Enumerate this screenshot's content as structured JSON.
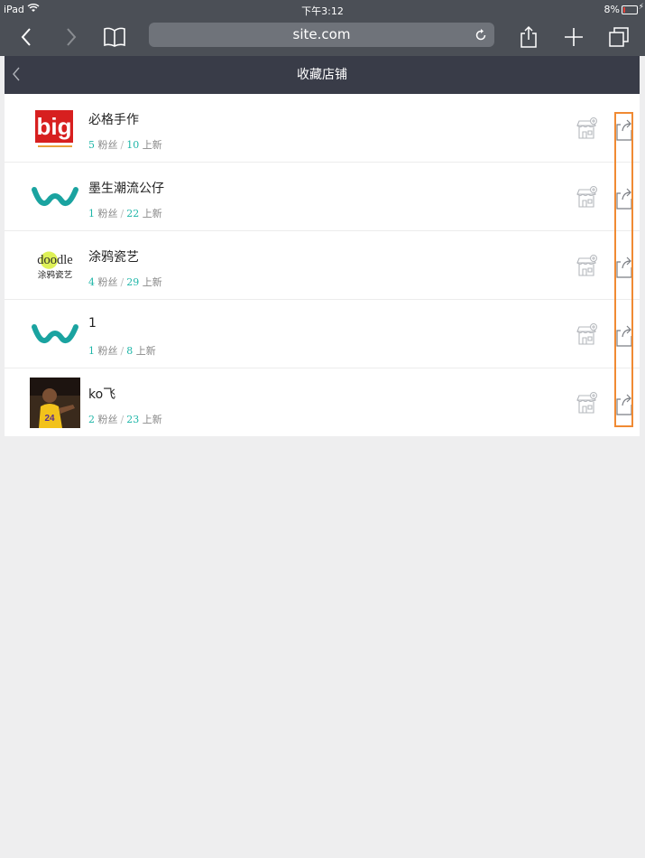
{
  "status_bar": {
    "device": "iPad",
    "time": "下午3:12",
    "battery": "8%"
  },
  "browser": {
    "url": "site.com"
  },
  "header": {
    "title": "收藏店铺"
  },
  "shops": [
    {
      "name": "必格手作",
      "fans": "5",
      "fans_label": "粉丝",
      "new": "10",
      "new_label": "上新",
      "logo_text": "big"
    },
    {
      "name": "墨生潮流公仔",
      "fans": "1",
      "fans_label": "粉丝",
      "new": "22",
      "new_label": "上新",
      "logo_text": "w"
    },
    {
      "name": "涂鸦瓷艺",
      "fans": "4",
      "fans_label": "粉丝",
      "new": "29",
      "new_label": "上新",
      "logo_text": "doodle",
      "logo_sub": "涂鸦瓷艺"
    },
    {
      "name": "1",
      "fans": "1",
      "fans_label": "粉丝",
      "new": "8",
      "new_label": "上新",
      "logo_text": "w"
    },
    {
      "name": "ko飞",
      "fans": "2",
      "fans_label": "粉丝",
      "new": "23",
      "new_label": "上新",
      "logo_text": ""
    }
  ]
}
